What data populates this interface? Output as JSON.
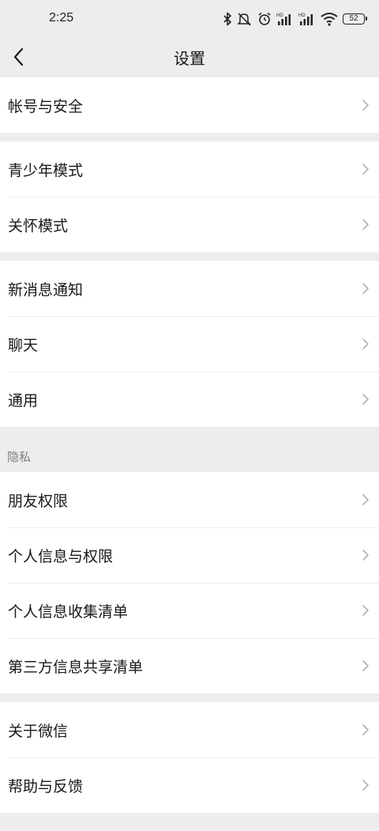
{
  "status_bar": {
    "time": "2:25",
    "battery_level": "52",
    "icons": [
      "bluetooth-icon",
      "mute-icon",
      "alarm-icon",
      "hd-signal-icon",
      "hd-signal-icon",
      "wifi-icon",
      "battery-icon"
    ],
    "hd_label": "HD"
  },
  "header": {
    "title": "设置",
    "back_icon": "chevron-left-icon"
  },
  "groups": [
    {
      "items": [
        {
          "label": "帐号与安全"
        }
      ]
    },
    {
      "items": [
        {
          "label": "青少年模式"
        },
        {
          "label": "关怀模式"
        }
      ]
    },
    {
      "items": [
        {
          "label": "新消息通知"
        },
        {
          "label": "聊天"
        },
        {
          "label": "通用"
        }
      ]
    },
    {
      "header": "隐私",
      "items": [
        {
          "label": "朋友权限"
        },
        {
          "label": "个人信息与权限"
        },
        {
          "label": "个人信息收集清单"
        },
        {
          "label": "第三方信息共享清单"
        }
      ]
    },
    {
      "items": [
        {
          "label": "关于微信"
        },
        {
          "label": "帮助与反馈"
        }
      ]
    }
  ],
  "colors": {
    "background": "#ededed",
    "row_background": "#ffffff",
    "text": "#191919",
    "secondary_text": "#7f7f7f",
    "chevron": "#b2b2b2"
  }
}
